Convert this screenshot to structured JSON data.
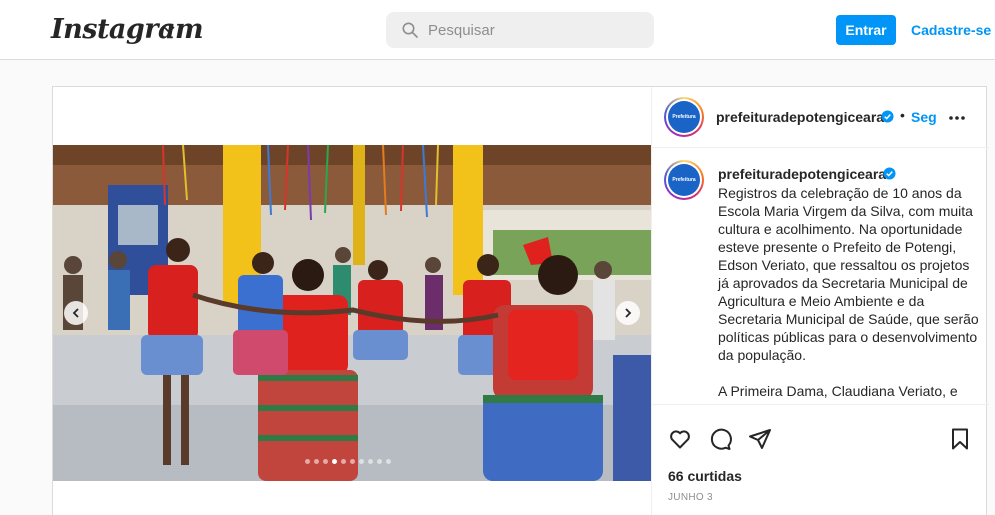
{
  "header": {
    "logo_text": "Instagram",
    "search_placeholder": "Pesquisar",
    "login_label": "Entrar",
    "signup_label": "Cadastre-se"
  },
  "post": {
    "username": "prefeituradepotengiceara",
    "follow_label": "Seg",
    "separator": "•",
    "avatar_text": "Prefeitura",
    "caption": "Registros da celebração de 10 anos da Escola Maria Virgem da Silva, com muita cultura e acolhimento. Na oportunidade esteve presente o Prefeito de Potengi, Edson Veriato, que ressaltou os projetos já aprovados da Secretaria Municipal de Agricultura e Meio Ambiente e da Secretaria Municipal de Saúde, que serão políticas públicas para o desenvolvimento da população.\n\nA Primeira Dama, Claudiana Veriato, e",
    "likes": "66 curtidas",
    "date": "JUNHO 3",
    "carousel_total": 10,
    "carousel_active": 4
  },
  "colors": {
    "accent": "#0095f6",
    "verified": "#0095f6",
    "border": "#dbdbdb"
  },
  "icons": [
    "instagram-logo",
    "chevron-down-icon",
    "search-icon",
    "verified-badge-icon",
    "more-icon",
    "heart-icon",
    "comment-icon",
    "share-icon",
    "bookmark-icon",
    "chevron-left-icon",
    "chevron-right-icon"
  ]
}
